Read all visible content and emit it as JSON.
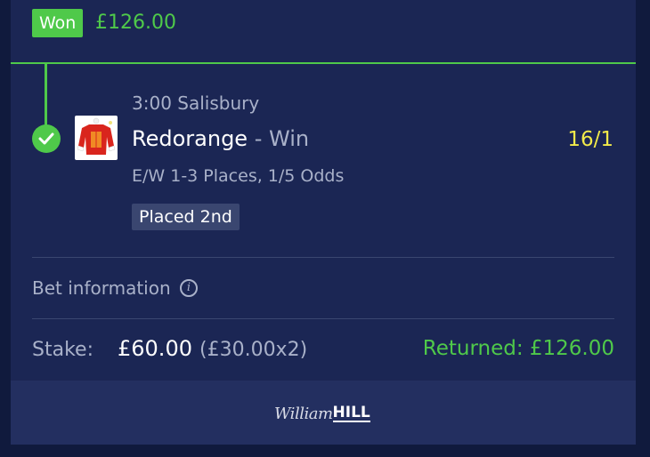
{
  "header": {
    "status_badge": "Won",
    "amount": "£126.00"
  },
  "selection": {
    "event": "3:00 Salisbury",
    "runner": "Redorange",
    "separator": " - ",
    "market": "Win",
    "odds": "16/1",
    "each_way_terms": "E/W 1-3 Places, 1/5 Odds",
    "result_badge": "Placed 2nd"
  },
  "bet_info": {
    "label": "Bet information"
  },
  "stake": {
    "label": "Stake:",
    "value": "£60.00",
    "detail": "(£30.00x2)",
    "returned": "Returned: £126.00"
  },
  "footer": {
    "logo_script": "William",
    "logo_bold": "HILL"
  },
  "colors": {
    "background": "#101a3d",
    "card": "#1b2654",
    "accent_green": "#4fc94a",
    "odds_yellow": "#f2ea4a",
    "muted_text": "#a9b1c9"
  }
}
